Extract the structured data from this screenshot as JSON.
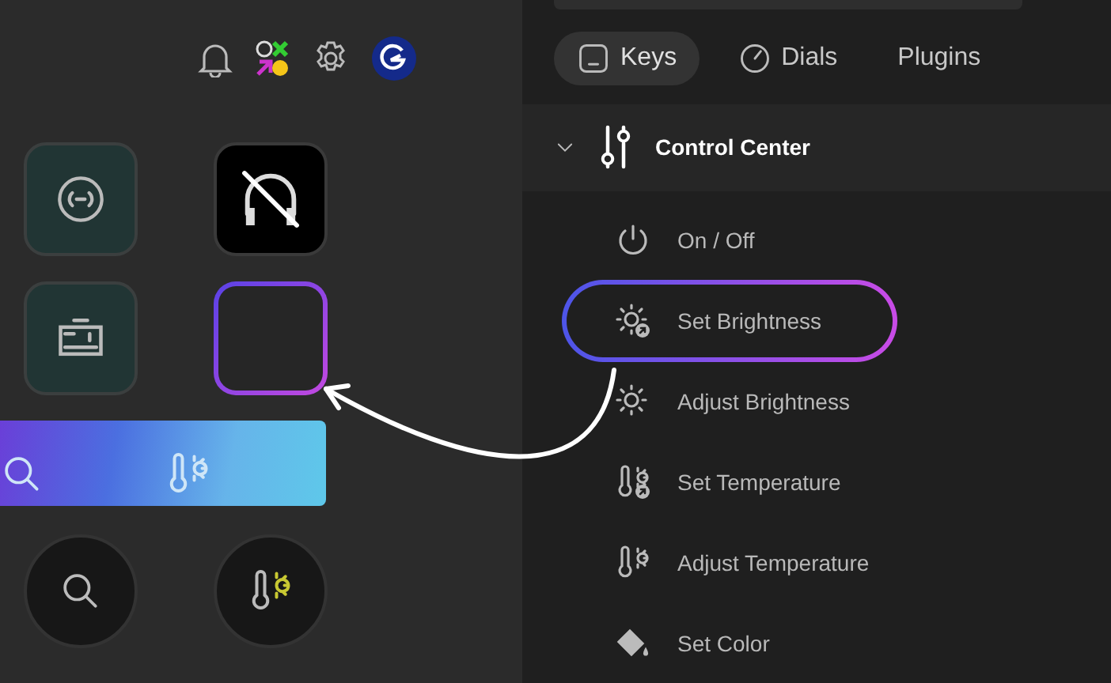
{
  "tabs": [
    {
      "label": "Keys",
      "kind": "keys",
      "selected": true
    },
    {
      "label": "Dials",
      "kind": "dials",
      "selected": false
    },
    {
      "label": "Plugins",
      "kind": "plugins",
      "selected": false
    }
  ],
  "group": {
    "title": "Control Center",
    "expanded": true
  },
  "actions": [
    {
      "label": "On / Off",
      "kind": "power",
      "highlighted": false
    },
    {
      "label": "Set Brightness",
      "kind": "set-brightness",
      "highlighted": true
    },
    {
      "label": "Adjust Brightness",
      "kind": "brightness",
      "highlighted": false
    },
    {
      "label": "Set Temperature",
      "kind": "set-temperature",
      "highlighted": false
    },
    {
      "label": "Adjust Temperature",
      "kind": "temperature",
      "highlighted": false
    },
    {
      "label": "Set Color",
      "kind": "color",
      "highlighted": false
    }
  ],
  "keys": [
    {
      "kind": "broadcast",
      "highlighted": false
    },
    {
      "kind": "headphones-muted",
      "highlighted": false
    },
    {
      "kind": "card",
      "highlighted": false
    },
    {
      "kind": "empty",
      "highlighted": true
    }
  ],
  "dials": [
    {
      "kind": "search"
    },
    {
      "kind": "temperature"
    }
  ]
}
